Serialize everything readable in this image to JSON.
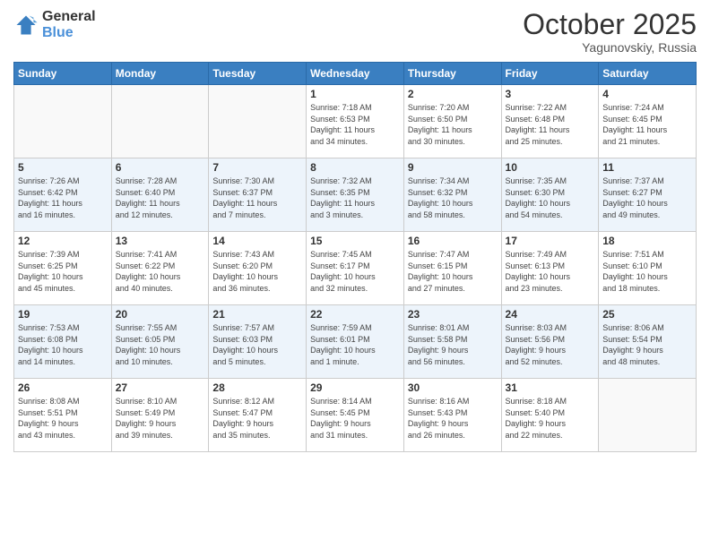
{
  "header": {
    "logo_general": "General",
    "logo_blue": "Blue",
    "month_title": "October 2025",
    "location": "Yagunovskiy, Russia"
  },
  "weekdays": [
    "Sunday",
    "Monday",
    "Tuesday",
    "Wednesday",
    "Thursday",
    "Friday",
    "Saturday"
  ],
  "weeks": [
    [
      {
        "day": "",
        "info": ""
      },
      {
        "day": "",
        "info": ""
      },
      {
        "day": "",
        "info": ""
      },
      {
        "day": "1",
        "info": "Sunrise: 7:18 AM\nSunset: 6:53 PM\nDaylight: 11 hours\nand 34 minutes."
      },
      {
        "day": "2",
        "info": "Sunrise: 7:20 AM\nSunset: 6:50 PM\nDaylight: 11 hours\nand 30 minutes."
      },
      {
        "day": "3",
        "info": "Sunrise: 7:22 AM\nSunset: 6:48 PM\nDaylight: 11 hours\nand 25 minutes."
      },
      {
        "day": "4",
        "info": "Sunrise: 7:24 AM\nSunset: 6:45 PM\nDaylight: 11 hours\nand 21 minutes."
      }
    ],
    [
      {
        "day": "5",
        "info": "Sunrise: 7:26 AM\nSunset: 6:42 PM\nDaylight: 11 hours\nand 16 minutes."
      },
      {
        "day": "6",
        "info": "Sunrise: 7:28 AM\nSunset: 6:40 PM\nDaylight: 11 hours\nand 12 minutes."
      },
      {
        "day": "7",
        "info": "Sunrise: 7:30 AM\nSunset: 6:37 PM\nDaylight: 11 hours\nand 7 minutes."
      },
      {
        "day": "8",
        "info": "Sunrise: 7:32 AM\nSunset: 6:35 PM\nDaylight: 11 hours\nand 3 minutes."
      },
      {
        "day": "9",
        "info": "Sunrise: 7:34 AM\nSunset: 6:32 PM\nDaylight: 10 hours\nand 58 minutes."
      },
      {
        "day": "10",
        "info": "Sunrise: 7:35 AM\nSunset: 6:30 PM\nDaylight: 10 hours\nand 54 minutes."
      },
      {
        "day": "11",
        "info": "Sunrise: 7:37 AM\nSunset: 6:27 PM\nDaylight: 10 hours\nand 49 minutes."
      }
    ],
    [
      {
        "day": "12",
        "info": "Sunrise: 7:39 AM\nSunset: 6:25 PM\nDaylight: 10 hours\nand 45 minutes."
      },
      {
        "day": "13",
        "info": "Sunrise: 7:41 AM\nSunset: 6:22 PM\nDaylight: 10 hours\nand 40 minutes."
      },
      {
        "day": "14",
        "info": "Sunrise: 7:43 AM\nSunset: 6:20 PM\nDaylight: 10 hours\nand 36 minutes."
      },
      {
        "day": "15",
        "info": "Sunrise: 7:45 AM\nSunset: 6:17 PM\nDaylight: 10 hours\nand 32 minutes."
      },
      {
        "day": "16",
        "info": "Sunrise: 7:47 AM\nSunset: 6:15 PM\nDaylight: 10 hours\nand 27 minutes."
      },
      {
        "day": "17",
        "info": "Sunrise: 7:49 AM\nSunset: 6:13 PM\nDaylight: 10 hours\nand 23 minutes."
      },
      {
        "day": "18",
        "info": "Sunrise: 7:51 AM\nSunset: 6:10 PM\nDaylight: 10 hours\nand 18 minutes."
      }
    ],
    [
      {
        "day": "19",
        "info": "Sunrise: 7:53 AM\nSunset: 6:08 PM\nDaylight: 10 hours\nand 14 minutes."
      },
      {
        "day": "20",
        "info": "Sunrise: 7:55 AM\nSunset: 6:05 PM\nDaylight: 10 hours\nand 10 minutes."
      },
      {
        "day": "21",
        "info": "Sunrise: 7:57 AM\nSunset: 6:03 PM\nDaylight: 10 hours\nand 5 minutes."
      },
      {
        "day": "22",
        "info": "Sunrise: 7:59 AM\nSunset: 6:01 PM\nDaylight: 10 hours\nand 1 minute."
      },
      {
        "day": "23",
        "info": "Sunrise: 8:01 AM\nSunset: 5:58 PM\nDaylight: 9 hours\nand 56 minutes."
      },
      {
        "day": "24",
        "info": "Sunrise: 8:03 AM\nSunset: 5:56 PM\nDaylight: 9 hours\nand 52 minutes."
      },
      {
        "day": "25",
        "info": "Sunrise: 8:06 AM\nSunset: 5:54 PM\nDaylight: 9 hours\nand 48 minutes."
      }
    ],
    [
      {
        "day": "26",
        "info": "Sunrise: 8:08 AM\nSunset: 5:51 PM\nDaylight: 9 hours\nand 43 minutes."
      },
      {
        "day": "27",
        "info": "Sunrise: 8:10 AM\nSunset: 5:49 PM\nDaylight: 9 hours\nand 39 minutes."
      },
      {
        "day": "28",
        "info": "Sunrise: 8:12 AM\nSunset: 5:47 PM\nDaylight: 9 hours\nand 35 minutes."
      },
      {
        "day": "29",
        "info": "Sunrise: 8:14 AM\nSunset: 5:45 PM\nDaylight: 9 hours\nand 31 minutes."
      },
      {
        "day": "30",
        "info": "Sunrise: 8:16 AM\nSunset: 5:43 PM\nDaylight: 9 hours\nand 26 minutes."
      },
      {
        "day": "31",
        "info": "Sunrise: 8:18 AM\nSunset: 5:40 PM\nDaylight: 9 hours\nand 22 minutes."
      },
      {
        "day": "",
        "info": ""
      }
    ]
  ]
}
